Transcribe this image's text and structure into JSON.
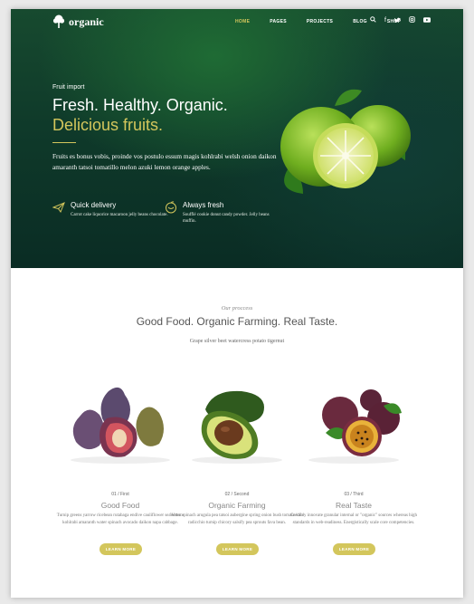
{
  "brand": {
    "name": "organic"
  },
  "nav": {
    "items": [
      {
        "label": "HOME",
        "active": true
      },
      {
        "label": "PAGES"
      },
      {
        "label": "PROJECTS"
      },
      {
        "label": "BLOG"
      },
      {
        "label": "SHOP"
      }
    ],
    "icons": [
      "search-icon",
      "facebook-icon",
      "twitter-icon",
      "instagram-icon",
      "youtube-icon"
    ]
  },
  "hero": {
    "eyebrow": "Fruit import",
    "title_line1": "Fresh. Healthy. Organic.",
    "title_line2": "Delicious fruits.",
    "paragraph": "Fruits es bonus vobis, proinde vos postulo essum magis kohlrabi welsh onion daikon amaranth tatsoi tomatillo melon azuki lemon orange apples.",
    "features": [
      {
        "icon": "paper-plane-icon",
        "title": "Quick delivery",
        "description": "Carrot cake liquorice macaroon jelly beans chocolate."
      },
      {
        "icon": "fruit-basket-icon",
        "title": "Always fresh",
        "description": "Soufflé cookie donut candy powder. Jelly beans muffin."
      }
    ]
  },
  "process": {
    "eyebrow": "Our proccess",
    "title": "Good Food. Organic Farming. Real Taste.",
    "subtitle": "Grape silver beet watercress potato tigernut",
    "cards": [
      {
        "step": "01 / First",
        "title": "Good Food",
        "description": "Turnip greens yarrow ricebean rutabaga endive cauliflower sea lettuce kohlrabi amaranth water spinach avocado daikon napa cabbage.",
        "button": "LEARN MORE",
        "image": "figs"
      },
      {
        "step": "02 / Second",
        "title": "Organic Farming",
        "description": "Water spinach arugula pea tatsoi aubergine spring onion bush tomato kale radicchio turnip chicory salsify pea sprouts fava bean.",
        "button": "LEARN MORE",
        "image": "avocado"
      },
      {
        "step": "03 / Third",
        "title": "Real Taste",
        "description": "Credibly innovate granular internal or \"organic\" sources whereas high standards in web-readiness. Energistically scale core competencies.",
        "button": "LEARN MORE",
        "image": "passion-fruit"
      }
    ]
  },
  "colors": {
    "accent": "#d3c65c",
    "hero_dark": "#0f3a2a"
  }
}
